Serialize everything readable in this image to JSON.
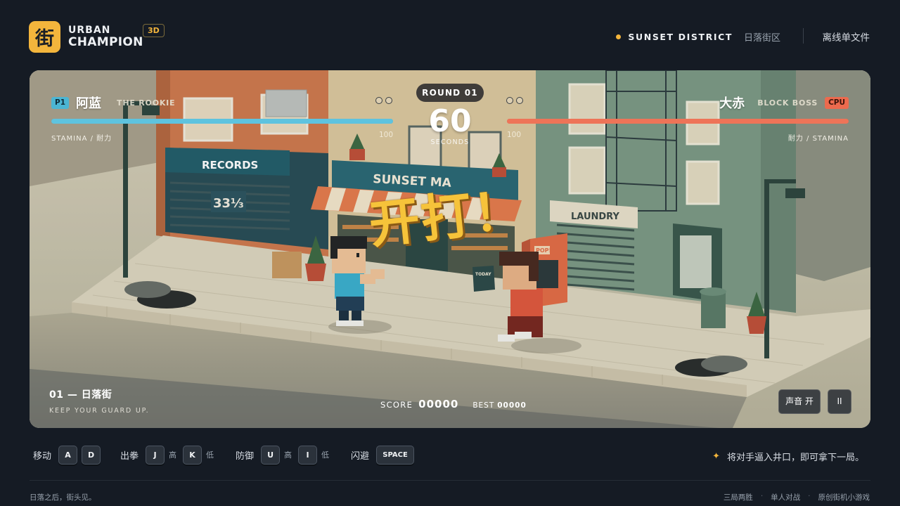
{
  "header": {
    "logo_char": "街",
    "brand_line1": "URBAN",
    "brand_line2": "CHAMPION",
    "mode_badge": "3D",
    "district_en": "SUNSET DISTRICT",
    "district_cn": "日落街区",
    "offline_link": "离线单文件"
  },
  "hud": {
    "p1": {
      "tag": "P1",
      "name": "阿蓝",
      "title": "THE ROOKIE",
      "stamina_label": "STAMINA / 耐力",
      "hp": "100"
    },
    "cpu": {
      "tag": "CPU",
      "name": "大赤",
      "title": "BLOCK BOSS",
      "stamina_label": "耐力 / STAMINA",
      "hp": "100"
    },
    "round": "ROUND 01",
    "timer": "60",
    "timer_label": "SECONDS"
  },
  "stage": {
    "signs": {
      "records": "RECORDS",
      "records_price": "33⅓",
      "market": "SUNSET MA",
      "laundry": "LAUNDRY",
      "pop": "POP!",
      "today": "TODAY"
    },
    "fight_text": "开打！",
    "title": "01 — 日落街",
    "tip": "KEEP YOUR GUARD UP.",
    "score_label": "SCORE",
    "score": "00000",
    "best_label": "BEST",
    "best": "00000",
    "sound_button": "声音 开",
    "pause_button": "II"
  },
  "controls": {
    "move_label": "移动",
    "move_keys": [
      "A",
      "D"
    ],
    "punch_label": "出拳",
    "punch_high_key": "J",
    "high_label": "高",
    "punch_low_key": "K",
    "low_label": "低",
    "guard_label": "防御",
    "guard_high_key": "U",
    "guard_low_key": "I",
    "dodge_label": "闪避",
    "dodge_key": "SPACE",
    "hint": "将对手逼入井口，即可拿下一局。"
  },
  "footer": {
    "left": "日落之后，街头见。",
    "links": [
      "三局两胜",
      "单人对战",
      "原创街机小游戏"
    ]
  },
  "colors": {
    "accent": "#f3b53c",
    "p1_bar": "#5ec3df",
    "cpu_bar": "#ee7458",
    "background": "#151b24"
  },
  "stamina": {
    "p1_fraction": 1.0,
    "cpu_fraction": 1.0
  },
  "icons": {
    "hint": "sparkle-icon",
    "status_dot": "dot-icon"
  }
}
